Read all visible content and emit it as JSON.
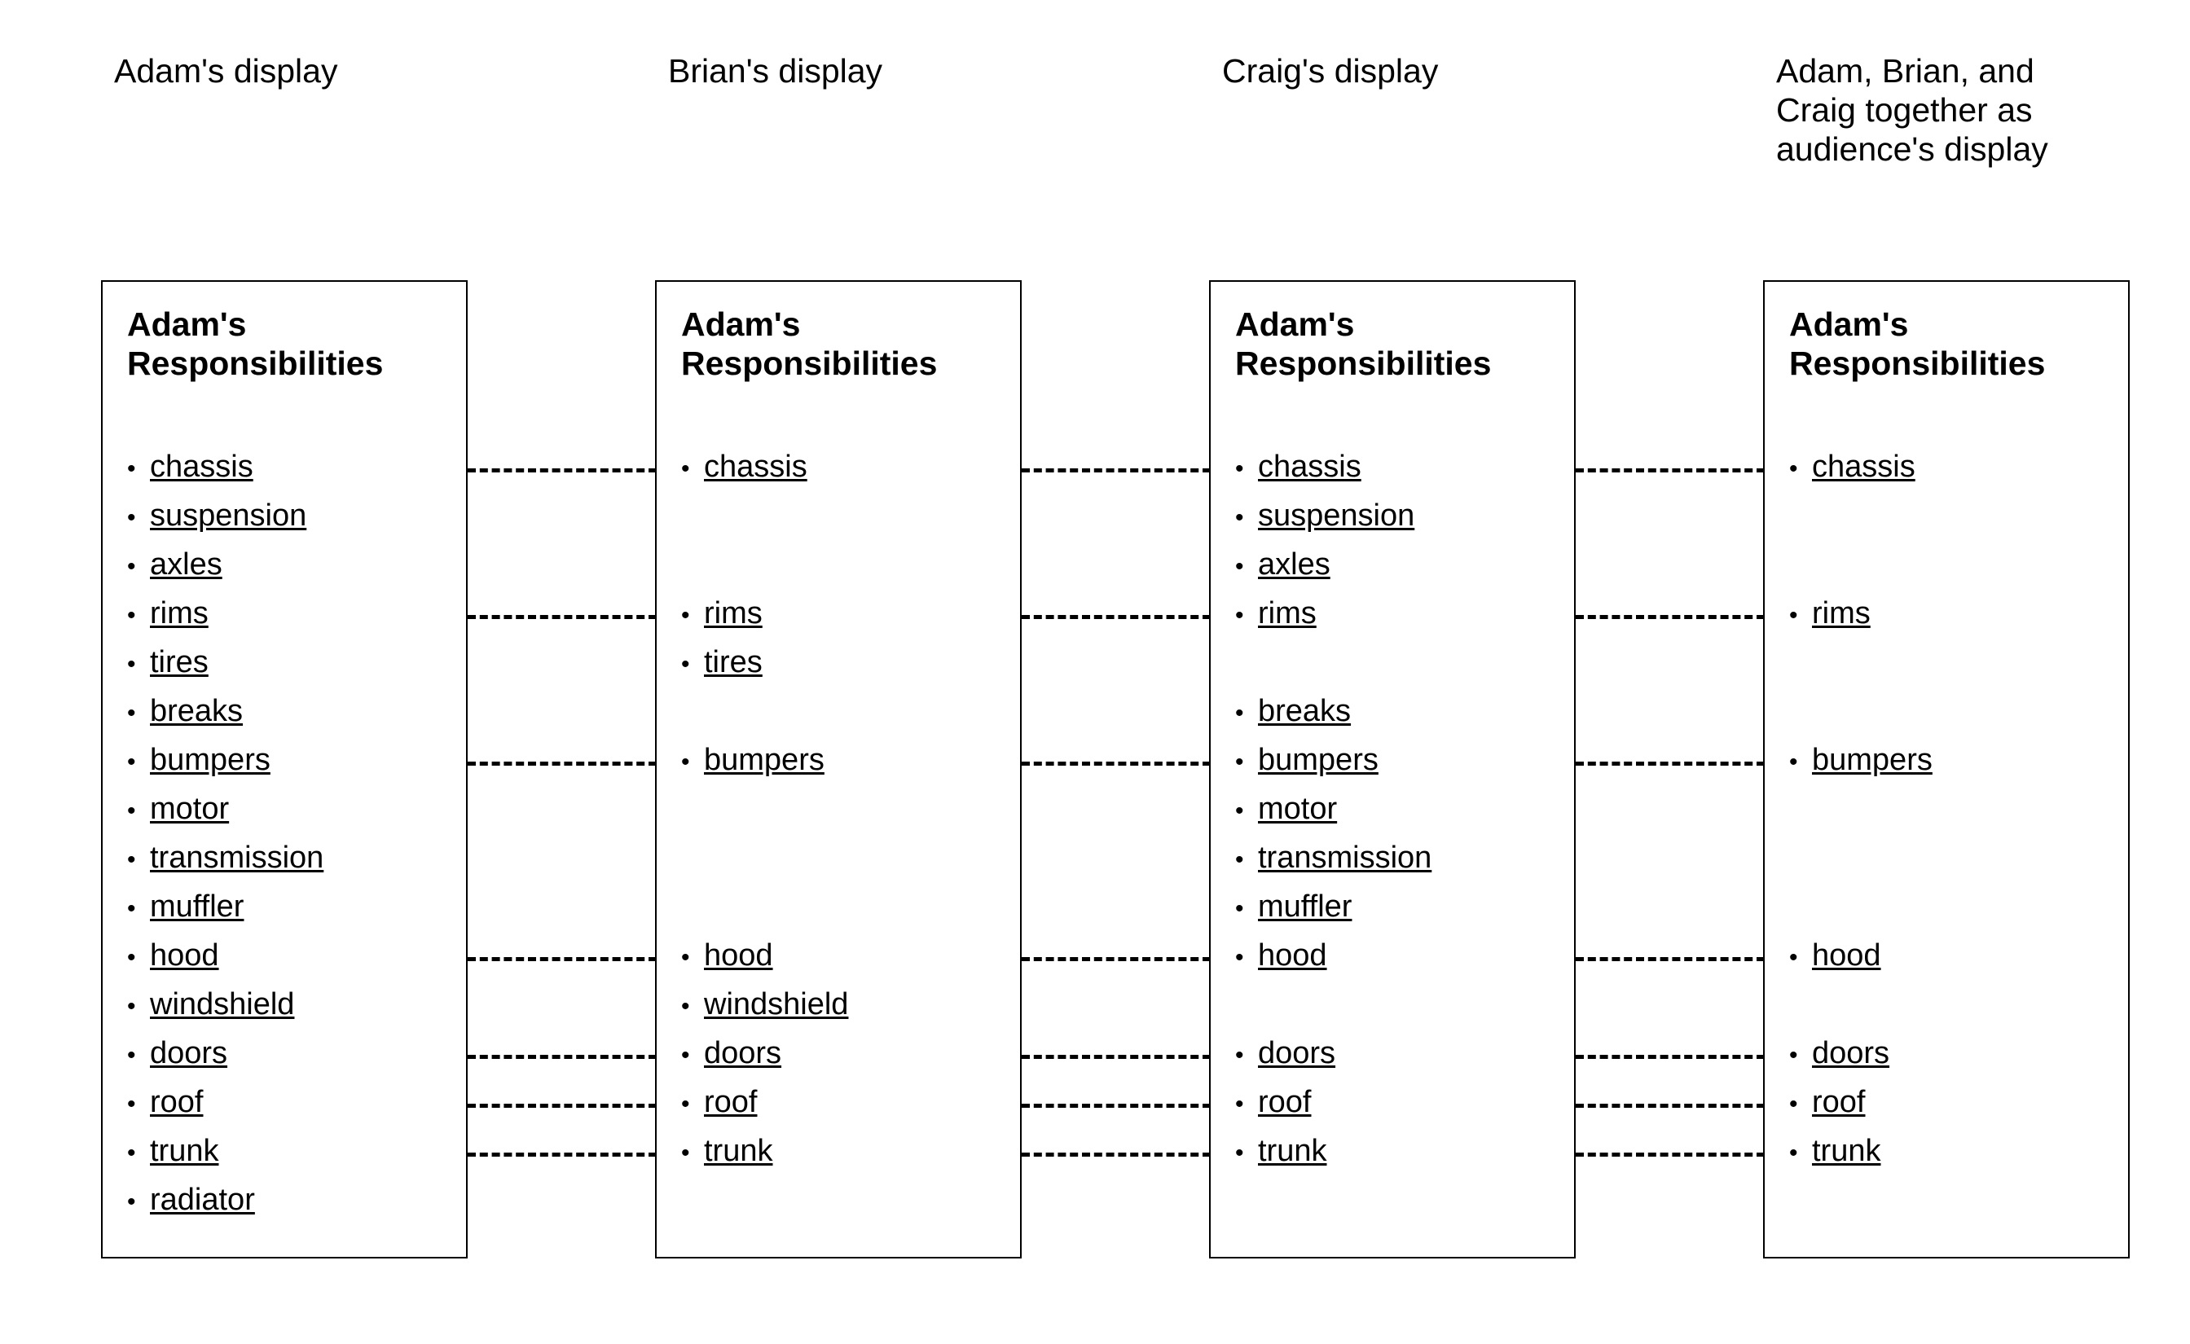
{
  "columns": [
    {
      "heading": "Adam's display",
      "box_title": "Adam's\nResponsibilities",
      "items": [
        "chassis",
        "suspension",
        "axles",
        "rims",
        "tires",
        "breaks",
        "bumpers",
        "motor",
        "transmission",
        "muffler",
        "hood",
        "windshield",
        "doors",
        "roof",
        "trunk",
        "radiator"
      ]
    },
    {
      "heading": "Brian's display",
      "box_title": "Adam's\nResponsibilities",
      "items": [
        "chassis",
        "",
        "",
        "rims",
        "tires",
        "",
        "bumpers",
        "",
        "",
        "",
        "hood",
        "windshield",
        "doors",
        "roof",
        "trunk",
        ""
      ]
    },
    {
      "heading": "Craig's display",
      "box_title": "Adam's\nResponsibilities",
      "items": [
        "chassis",
        "suspension",
        "axles",
        "rims",
        "",
        "breaks",
        "bumpers",
        "motor",
        "transmission",
        "muffler",
        "hood",
        "",
        "doors",
        "roof",
        "trunk",
        ""
      ]
    },
    {
      "heading": "Adam, Brian, and\nCraig together as\naudience's display",
      "box_title": "Adam's\nResponsibilities",
      "items": [
        "chassis",
        "",
        "",
        "rims",
        "",
        "",
        "bumpers",
        "",
        "",
        "",
        "hood",
        "",
        "doors",
        "roof",
        "trunk",
        ""
      ]
    }
  ],
  "connector_rows": [
    0,
    3,
    6,
    10,
    12,
    13,
    14
  ],
  "connector_gaps": 3,
  "style": {
    "line_color": "#000000",
    "box_border_color": "#000000",
    "background": "#ffffff"
  }
}
